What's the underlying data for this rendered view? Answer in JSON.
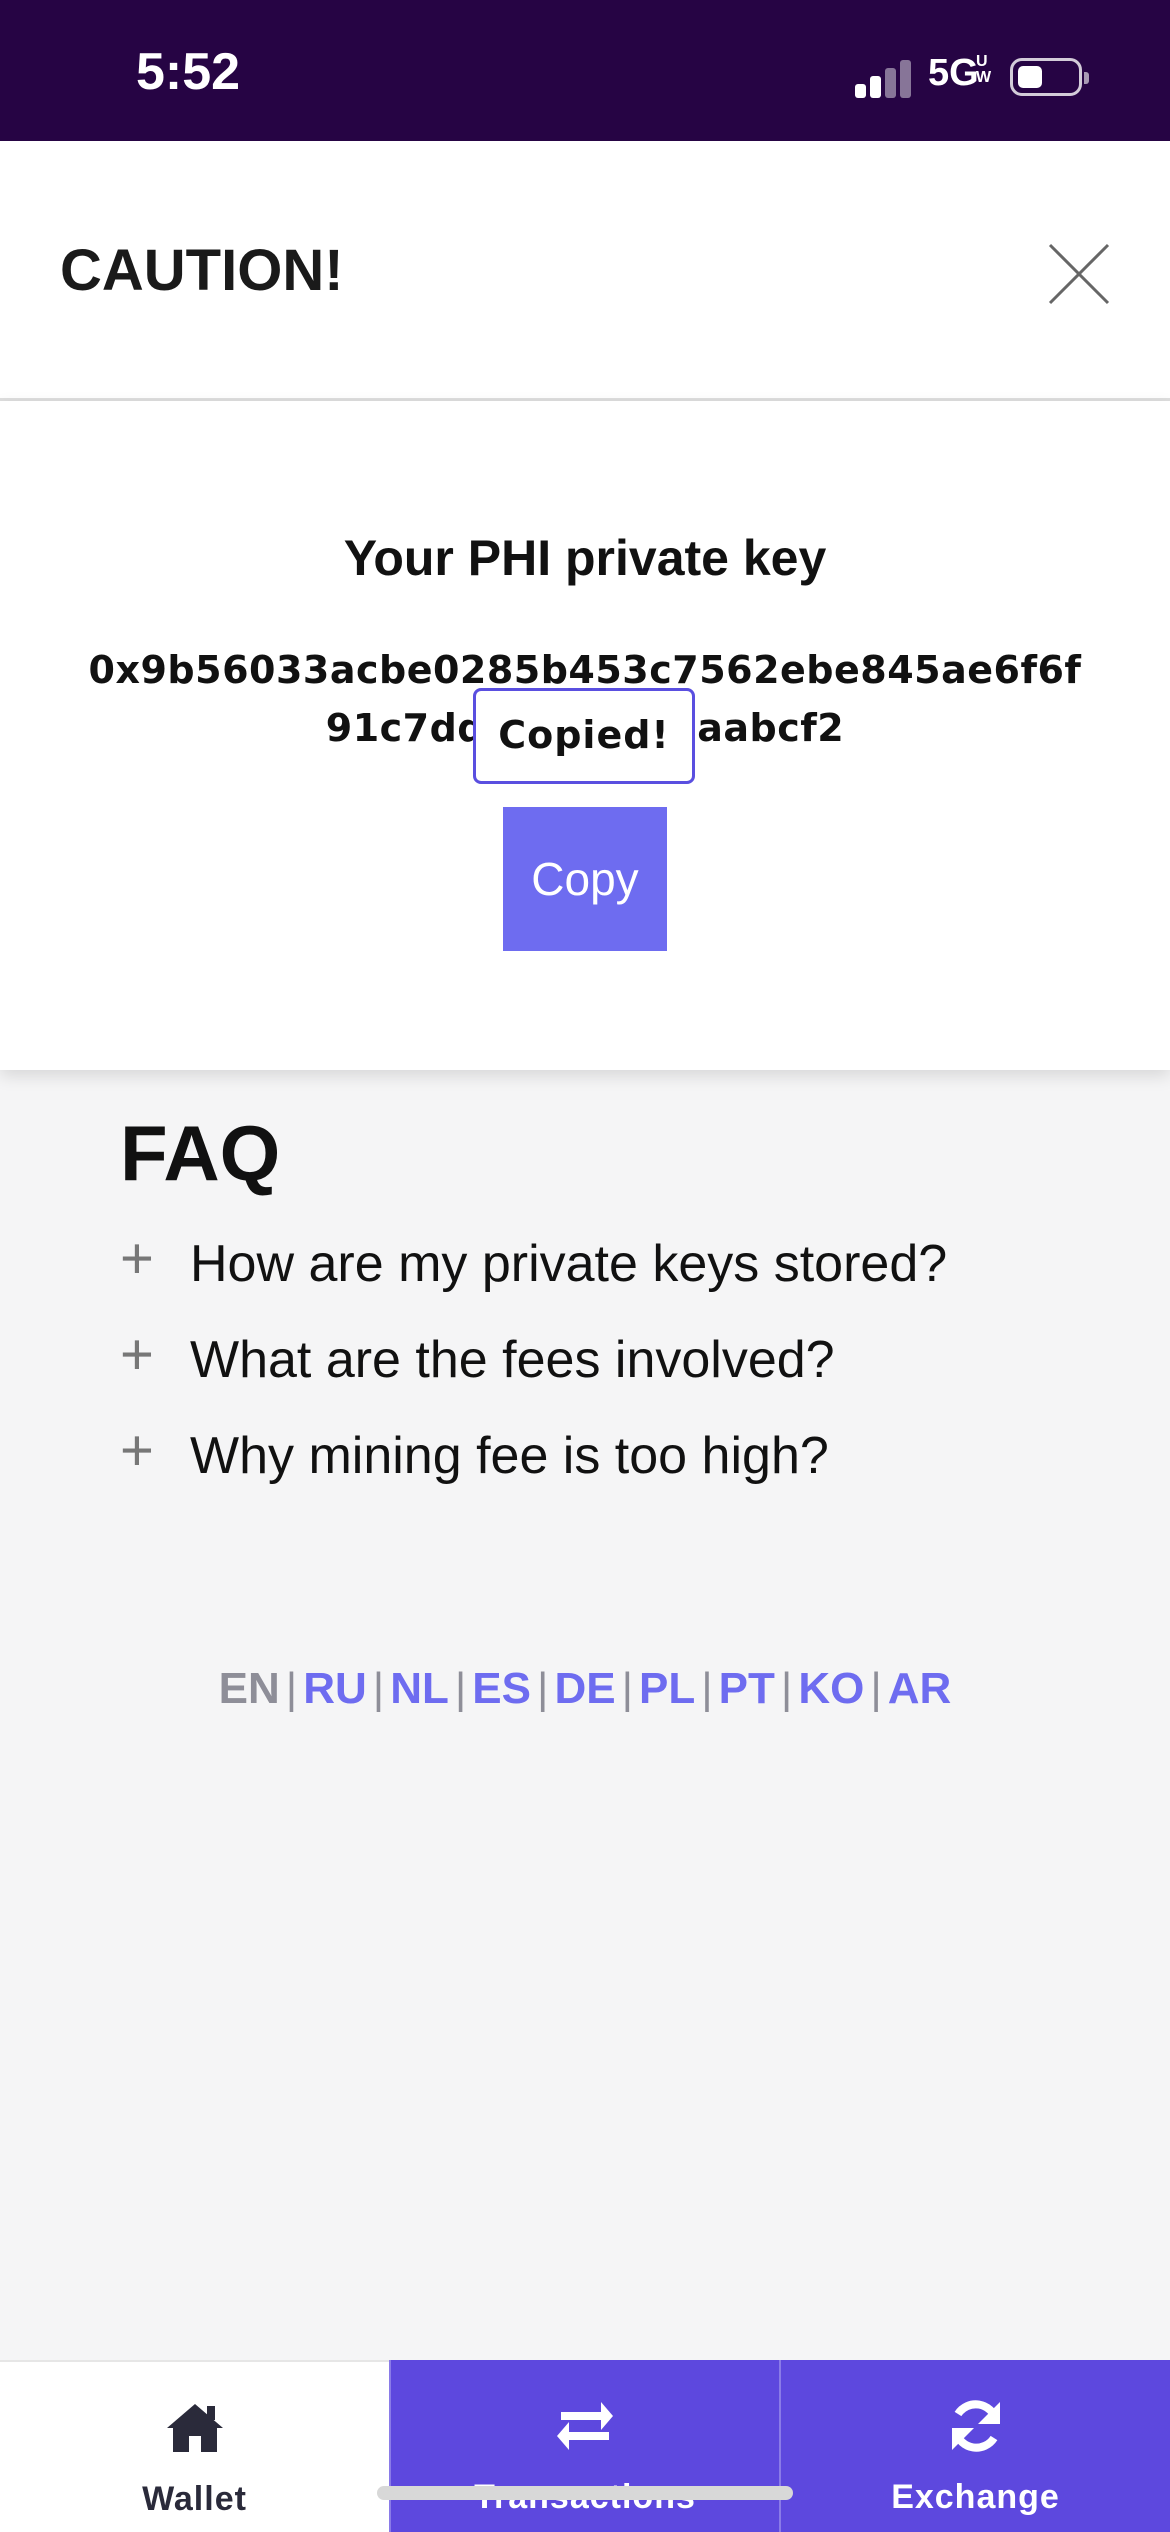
{
  "status_bar": {
    "time": "5:52",
    "network": "5G",
    "network_sup": "UW",
    "background": "#260444"
  },
  "modal": {
    "title": "CAUTION!",
    "close_icon": "close-x-icon",
    "key_heading": "Your PHI private key",
    "private_key": "0x9b56033acbe0285b453c7562ebe845ae6f6f91c7ddf776f...d8aabcf2",
    "copied_tooltip": "Copied!",
    "copy_label": "Copy",
    "accent": "#6e6cf0"
  },
  "faq": {
    "title": "FAQ",
    "items": [
      {
        "label": "How are my private keys stored?"
      },
      {
        "label": "What are the fees involved?"
      },
      {
        "label": "Why mining fee is too high?"
      }
    ]
  },
  "languages": {
    "active": "EN",
    "items": [
      "EN",
      "RU",
      "NL",
      "ES",
      "DE",
      "PL",
      "PT",
      "KO",
      "AR"
    ]
  },
  "bottom_nav": {
    "items": [
      {
        "label": "Wallet",
        "icon": "home-icon"
      },
      {
        "label": "Transactions",
        "icon": "swap-arrows-icon"
      },
      {
        "label": "Exchange",
        "icon": "refresh-icon"
      }
    ],
    "active_color": "#5d48de"
  }
}
